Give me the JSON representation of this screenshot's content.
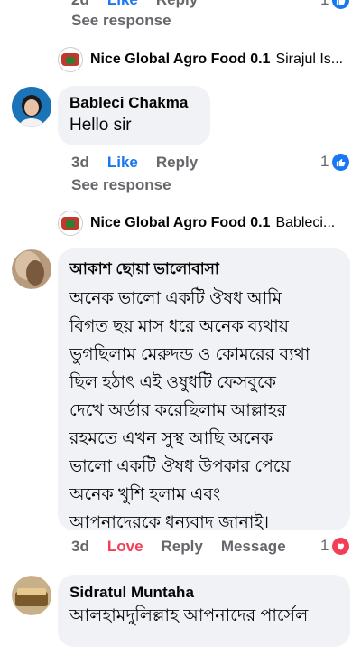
{
  "top_partial": {
    "time": "2d",
    "like": "Like",
    "reply": "Reply",
    "count": "1",
    "see_response": "See response"
  },
  "reply_thread_1": {
    "page_name": "Nice Global Agro Food 0.1",
    "snippet": "Sirajul Is..."
  },
  "comment_1": {
    "author": "Bableci Chakma",
    "text": "Hello sir",
    "time": "3d",
    "like": "Like",
    "reply": "Reply",
    "count": "1",
    "see_response": "See response"
  },
  "reply_thread_2": {
    "page_name": "Nice Global Agro Food 0.1",
    "snippet": "Bableci..."
  },
  "comment_2": {
    "author": "আকাশ ছোয়া ভালোবাসা",
    "lines": [
      "অনেক ভালো একটি ঔষধ আমি",
      "বিগত ছয় মাস ধরে  অনেক ব্যথায়",
      "ভুগছিলাম মেরুদন্ড ও কোমরের ব্যথা",
      "ছিল হঠাৎ এই ওষুধটি ফেসবুকে",
      "দেখে অর্ডার করেছিলাম আল্লাহর",
      "রহমতে এখন সুস্থ আছি অনেক",
      "ভালো একটি ঔষধ  উপকার পেয়ে",
      "অনেক খুশি হলাম এবং",
      "আপনাদেরকে ধন্যবাদ জানাই।"
    ],
    "time": "3d",
    "love": "Love",
    "reply": "Reply",
    "message": "Message",
    "count": "1"
  },
  "comment_3": {
    "author": "Sidratul Muntaha",
    "text": "আলহামদুলিল্লাহ আপনাদের পার্সেল"
  },
  "colors": {
    "like_blue": "#1877f2",
    "love_red": "#f33e58",
    "bubble_bg": "#f0f2f5",
    "meta_gray": "#65676b"
  },
  "icons": {
    "like": "thumbs-up-icon",
    "love": "heart-icon"
  }
}
